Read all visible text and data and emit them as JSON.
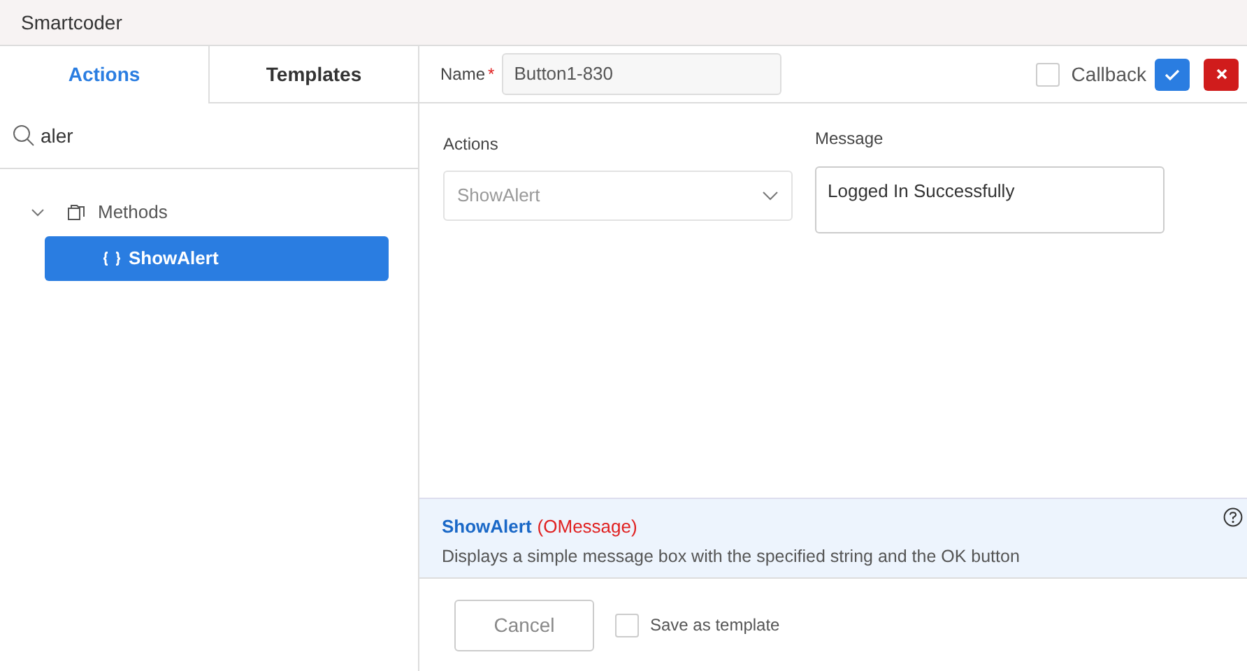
{
  "window": {
    "title": "Smartcoder"
  },
  "tabs": [
    {
      "label": "Actions",
      "selected": true
    },
    {
      "label": "Templates",
      "selected": false
    }
  ],
  "search": {
    "value": "aler"
  },
  "tree": [
    {
      "label": "Methods",
      "expanded": true,
      "children": [
        {
          "label": "ShowAlert",
          "selected": true
        }
      ]
    }
  ],
  "name_field": {
    "label": "Name",
    "required": "*",
    "value": "Button1-830"
  },
  "callback": {
    "label": "Callback",
    "checked": false
  },
  "actions_field": {
    "label": "Actions",
    "value": "ShowAlert"
  },
  "message_field": {
    "label": "Message",
    "value": "Logged In Successfully"
  },
  "info": {
    "method": "ShowAlert",
    "params": "(OMessage)",
    "description": "Displays a simple message box with the specified string and the OK button"
  },
  "footer": {
    "cancel": "Cancel",
    "save_template": {
      "label": "Save as template",
      "checked": false
    }
  }
}
